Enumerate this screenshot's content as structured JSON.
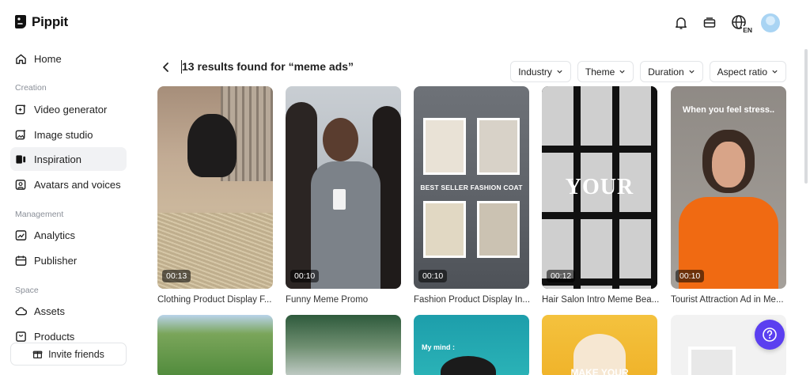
{
  "app": {
    "name": "Pippit"
  },
  "header": {
    "language_badge": "EN"
  },
  "sidebar": {
    "home": "Home",
    "sections": {
      "creation": "Creation",
      "management": "Management",
      "space": "Space"
    },
    "items": {
      "video_generator": "Video generator",
      "image_studio": "Image studio",
      "inspiration": "Inspiration",
      "avatars_voices": "Avatars and voices",
      "analytics": "Analytics",
      "publisher": "Publisher",
      "assets": "Assets",
      "products": "Products"
    },
    "invite": "Invite friends"
  },
  "results": {
    "title": "13 results found for “meme ads”"
  },
  "filters": [
    "Industry",
    "Theme",
    "Duration",
    "Aspect ratio"
  ],
  "cards": [
    {
      "duration": "00:13",
      "caption": "Clothing Product Display F..."
    },
    {
      "duration": "00:10",
      "caption": "Funny Meme Promo"
    },
    {
      "duration": "00:10",
      "caption": "Fashion Product Display In...",
      "overlay": "BEST SELLER FASHION COAT"
    },
    {
      "duration": "00:12",
      "caption": "Hair Salon Intro Meme Bea...",
      "overlay": "YOUR"
    },
    {
      "duration": "00:10",
      "caption": "Tourist Attraction Ad in Me...",
      "overlay": "When you feel stress.."
    }
  ],
  "row2": [
    {
      "overlay": ""
    },
    {
      "overlay": ""
    },
    {
      "overlay": "My mind :"
    },
    {
      "overlay": "MAKE YOUR"
    },
    {
      "overlay": ""
    }
  ],
  "colors": {
    "accent": "#5b3ff0",
    "active_nav": "#f1f2f4"
  }
}
